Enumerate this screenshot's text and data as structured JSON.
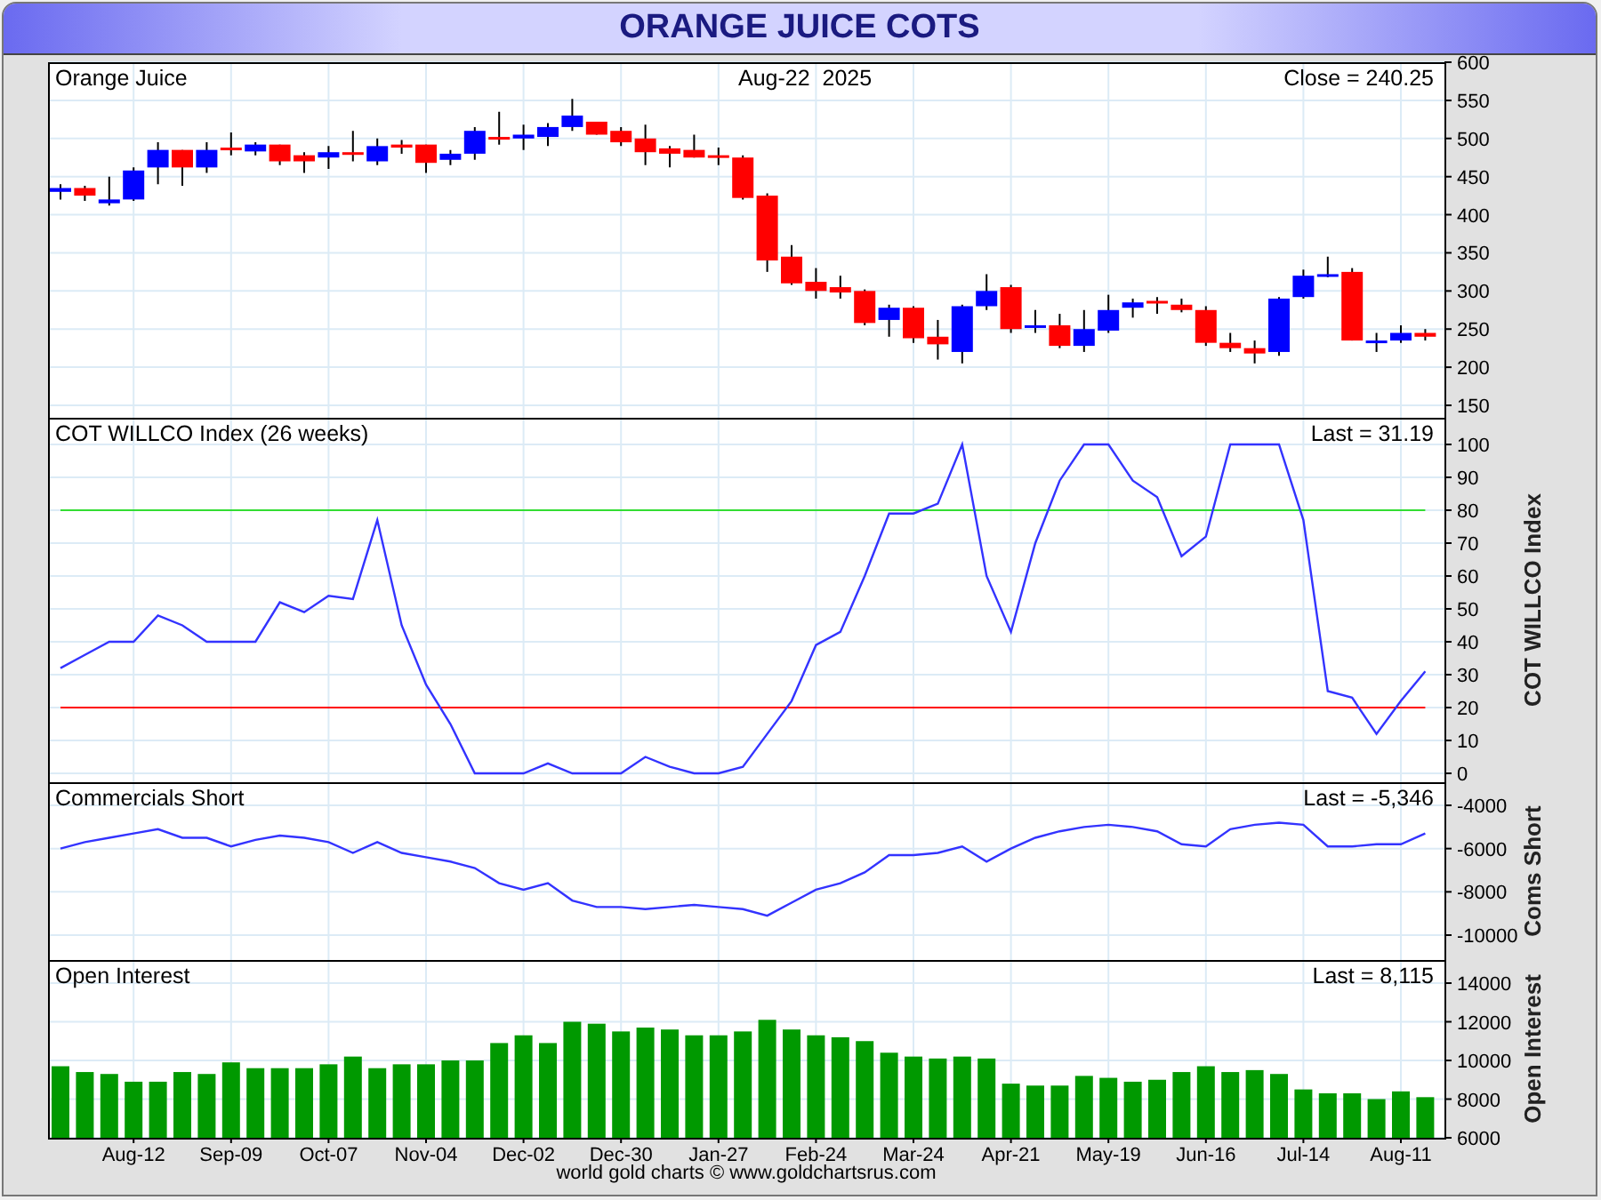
{
  "title": "ORANGE JUICE COTS",
  "panels": [
    {
      "heading": "Orange Juice",
      "date": "Aug-22  2025",
      "reading": "Close = 240.25",
      "chart_data": {
        "type": "candlestick",
        "grid": true,
        "ylim": [
          150,
          600
        ],
        "yticks": [
          150,
          200,
          250,
          300,
          350,
          400,
          450,
          500,
          550,
          600
        ],
        "ohlc": [
          [
            430,
            440,
            420,
            435
          ],
          [
            435,
            438,
            418,
            425
          ],
          [
            415,
            450,
            412,
            420
          ],
          [
            420,
            462,
            418,
            458
          ],
          [
            462,
            495,
            440,
            485
          ],
          [
            485,
            485,
            438,
            462
          ],
          [
            462,
            495,
            455,
            485
          ],
          [
            488,
            508,
            478,
            485
          ],
          [
            483,
            495,
            478,
            492
          ],
          [
            492,
            492,
            465,
            470
          ],
          [
            478,
            482,
            455,
            470
          ],
          [
            475,
            490,
            460,
            482
          ],
          [
            482,
            510,
            470,
            480
          ],
          [
            470,
            500,
            465,
            490
          ],
          [
            492,
            498,
            480,
            488
          ],
          [
            492,
            492,
            455,
            468
          ],
          [
            472,
            485,
            465,
            480
          ],
          [
            480,
            515,
            472,
            510
          ],
          [
            502,
            535,
            492,
            500
          ],
          [
            500,
            518,
            485,
            505
          ],
          [
            502,
            520,
            490,
            515
          ],
          [
            515,
            552,
            510,
            530
          ],
          [
            522,
            522,
            505,
            505
          ],
          [
            510,
            515,
            490,
            495
          ],
          [
            500,
            518,
            465,
            482
          ],
          [
            487,
            490,
            462,
            480
          ],
          [
            485,
            505,
            475,
            475
          ],
          [
            478,
            488,
            465,
            475
          ],
          [
            475,
            478,
            420,
            422
          ],
          [
            425,
            428,
            325,
            340
          ],
          [
            345,
            360,
            308,
            310
          ],
          [
            312,
            330,
            290,
            300
          ],
          [
            305,
            320,
            290,
            298
          ],
          [
            300,
            302,
            255,
            258
          ],
          [
            262,
            282,
            240,
            278
          ],
          [
            278,
            280,
            232,
            238
          ],
          [
            240,
            262,
            210,
            230
          ],
          [
            220,
            282,
            205,
            280
          ],
          [
            280,
            322,
            275,
            300
          ],
          [
            305,
            308,
            245,
            250
          ],
          [
            252,
            275,
            245,
            255
          ],
          [
            255,
            270,
            225,
            228
          ],
          [
            228,
            275,
            220,
            250
          ],
          [
            248,
            295,
            245,
            275
          ],
          [
            278,
            290,
            265,
            285
          ],
          [
            287,
            292,
            270,
            285
          ],
          [
            282,
            290,
            272,
            275
          ],
          [
            275,
            280,
            228,
            232
          ],
          [
            232,
            245,
            220,
            225
          ],
          [
            225,
            235,
            205,
            218
          ],
          [
            220,
            292,
            215,
            290
          ],
          [
            292,
            328,
            290,
            320
          ],
          [
            320,
            345,
            318,
            322
          ],
          [
            325,
            330,
            235,
            235
          ],
          [
            233,
            245,
            220,
            235
          ],
          [
            235,
            255,
            232,
            245
          ],
          [
            245,
            250,
            235,
            240
          ]
        ]
      }
    },
    {
      "heading": "COT WILLCO Index (26 weeks)",
      "reading": "Last = 31.19",
      "axis_title": "COT WILLCO Index",
      "chart_data": {
        "type": "line",
        "grid": true,
        "ylim": [
          0,
          100
        ],
        "yticks": [
          0,
          10,
          20,
          30,
          40,
          50,
          60,
          70,
          80,
          90,
          100
        ],
        "series": [
          {
            "color": "#33dd33",
            "values": [
              80,
              80,
              80,
              80,
              80,
              80,
              80,
              80,
              80,
              80,
              80,
              80,
              80,
              80,
              80,
              80,
              80,
              80,
              80,
              80,
              80,
              80,
              80,
              80,
              80,
              80,
              80,
              80,
              80,
              80,
              80,
              80,
              80,
              80,
              80,
              80,
              80,
              80,
              80,
              80,
              80,
              80,
              80,
              80,
              80,
              80,
              80,
              80,
              80,
              80,
              80,
              80,
              80,
              80,
              80,
              80,
              80
            ]
          },
          {
            "color": "#ff0000",
            "values": [
              20,
              20,
              20,
              20,
              20,
              20,
              20,
              20,
              20,
              20,
              20,
              20,
              20,
              20,
              20,
              20,
              20,
              20,
              20,
              20,
              20,
              20,
              20,
              20,
              20,
              20,
              20,
              20,
              20,
              20,
              20,
              20,
              20,
              20,
              20,
              20,
              20,
              20,
              20,
              20,
              20,
              20,
              20,
              20,
              20,
              20,
              20,
              20,
              20,
              20,
              20,
              20,
              20,
              20,
              20,
              20,
              20
            ]
          },
          {
            "color": "#3333ff",
            "values": [
              32,
              36,
              40,
              40,
              48,
              45,
              40,
              40,
              40,
              52,
              49,
              54,
              53,
              77,
              45,
              27,
              15,
              0,
              0,
              0,
              3,
              0,
              0,
              0,
              5,
              2,
              0,
              0,
              2,
              12,
              22,
              39,
              43,
              60,
              79,
              79,
              82,
              100,
              60,
              43,
              70,
              89,
              100,
              100,
              89,
              84,
              66,
              72,
              100,
              100,
              100,
              77,
              25,
              23,
              12,
              22,
              31
            ]
          }
        ]
      }
    },
    {
      "heading": "Commercials Short",
      "reading": "Last = -5,346",
      "axis_title": "Coms Short",
      "chart_data": {
        "type": "line",
        "grid": true,
        "ylim": [
          -10000,
          -4000
        ],
        "yticks": [
          -10000,
          -8000,
          -6000,
          -4000
        ],
        "series": [
          {
            "color": "#3333ff",
            "values": [
              -6000,
              -5700,
              -5500,
              -5300,
              -5100,
              -5500,
              -5500,
              -5900,
              -5600,
              -5400,
              -5500,
              -5700,
              -6200,
              -5700,
              -6200,
              -6400,
              -6600,
              -6900,
              -7600,
              -7900,
              -7600,
              -8400,
              -8700,
              -8700,
              -8800,
              -8700,
              -8600,
              -8700,
              -8800,
              -9100,
              -8500,
              -7900,
              -7600,
              -7100,
              -6300,
              -6300,
              -6200,
              -5900,
              -6600,
              -6000,
              -5500,
              -5200,
              -5000,
              -4900,
              -5000,
              -5200,
              -5800,
              -5900,
              -5100,
              -4900,
              -4800,
              -4900,
              -5900,
              -5900,
              -5800,
              -5800,
              -5300
            ]
          }
        ]
      }
    },
    {
      "heading": "Open Interest",
      "reading": "Last = 8,115",
      "axis_title": "Open Interest",
      "chart_data": {
        "type": "bar",
        "grid": true,
        "ylim": [
          6000,
          14000
        ],
        "yticks": [
          6000,
          8000,
          10000,
          12000,
          14000
        ],
        "series": [
          {
            "color": "#009900",
            "values": [
              9700,
              9400,
              9300,
              8900,
              8900,
              9400,
              9300,
              9900,
              9600,
              9600,
              9600,
              9800,
              10200,
              9600,
              9800,
              9800,
              10000,
              10000,
              10900,
              11300,
              10900,
              12000,
              11900,
              11500,
              11700,
              11600,
              11300,
              11300,
              11500,
              12100,
              11600,
              11300,
              11200,
              11000,
              10400,
              10200,
              10100,
              10200,
              10100,
              8800,
              8700,
              8700,
              9200,
              9100,
              8900,
              9000,
              9400,
              9700,
              9400,
              9500,
              9300,
              8500,
              8300,
              8300,
              8000,
              8400,
              8100
            ]
          }
        ]
      }
    }
  ],
  "xticks": [
    "Aug-12",
    "Sep-09",
    "Oct-07",
    "Nov-04",
    "Dec-02",
    "Dec-30",
    "Jan-27",
    "Feb-24",
    "Mar-24",
    "Apr-21",
    "May-19",
    "Jun-16",
    "Jul-14",
    "Aug-11"
  ],
  "footer": "world gold charts © www.goldchartsrus.com"
}
